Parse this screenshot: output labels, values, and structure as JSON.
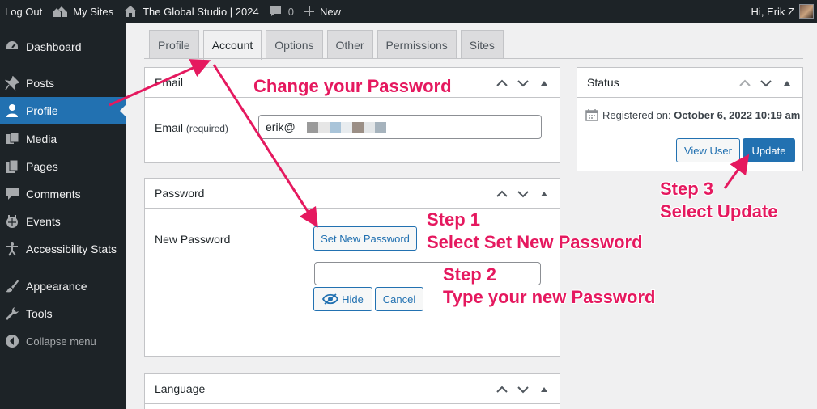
{
  "adminbar": {
    "logout": "Log Out",
    "my_sites": "My Sites",
    "site_name": "The Global Studio | 2024",
    "comments_count": "0",
    "new": "New",
    "greeting": "Hi, Erik Z"
  },
  "sidebar": {
    "items": [
      {
        "label": "Dashboard",
        "icon": "dashboard-icon"
      },
      {
        "label": "Posts",
        "icon": "pushpin-icon"
      },
      {
        "label": "Profile",
        "icon": "user-icon"
      },
      {
        "label": "Media",
        "icon": "media-icon"
      },
      {
        "label": "Pages",
        "icon": "pages-icon"
      },
      {
        "label": "Comments",
        "icon": "comment-icon"
      },
      {
        "label": "Events",
        "icon": "calendar-icon"
      },
      {
        "label": "Accessibility Stats",
        "icon": "accessibility-icon"
      },
      {
        "label": "Appearance",
        "icon": "paintbrush-icon"
      },
      {
        "label": "Tools",
        "icon": "wrench-icon"
      },
      {
        "label": "Collapse menu",
        "icon": "collapse-icon"
      }
    ]
  },
  "tabs": [
    "Profile",
    "Account",
    "Options",
    "Other",
    "Permissions",
    "Sites"
  ],
  "email_box": {
    "title": "Email",
    "label": "Email",
    "required": "(required)",
    "value": "erik@"
  },
  "password_box": {
    "title": "Password",
    "label": "New Password",
    "set_button": "Set New Password",
    "hide_button": "Hide",
    "cancel_button": "Cancel"
  },
  "language_box": {
    "title": "Language"
  },
  "status_box": {
    "title": "Status",
    "registered_label": "Registered on:",
    "registered_date": "October 6, 2022 10:19 am",
    "view_user": "View User",
    "update": "Update"
  },
  "annotations": {
    "change_password": "Change your Password",
    "step1_title": "Step 1",
    "step1_text": "Select Set New Password",
    "step2_title": "Step 2",
    "step2_text": "Type your new Password",
    "step3_title": "Step 3",
    "step3_text": "Select Update"
  },
  "colors": {
    "annotation": "#e5195f",
    "wp_blue": "#2271b1",
    "admin_dark": "#1d2327"
  }
}
